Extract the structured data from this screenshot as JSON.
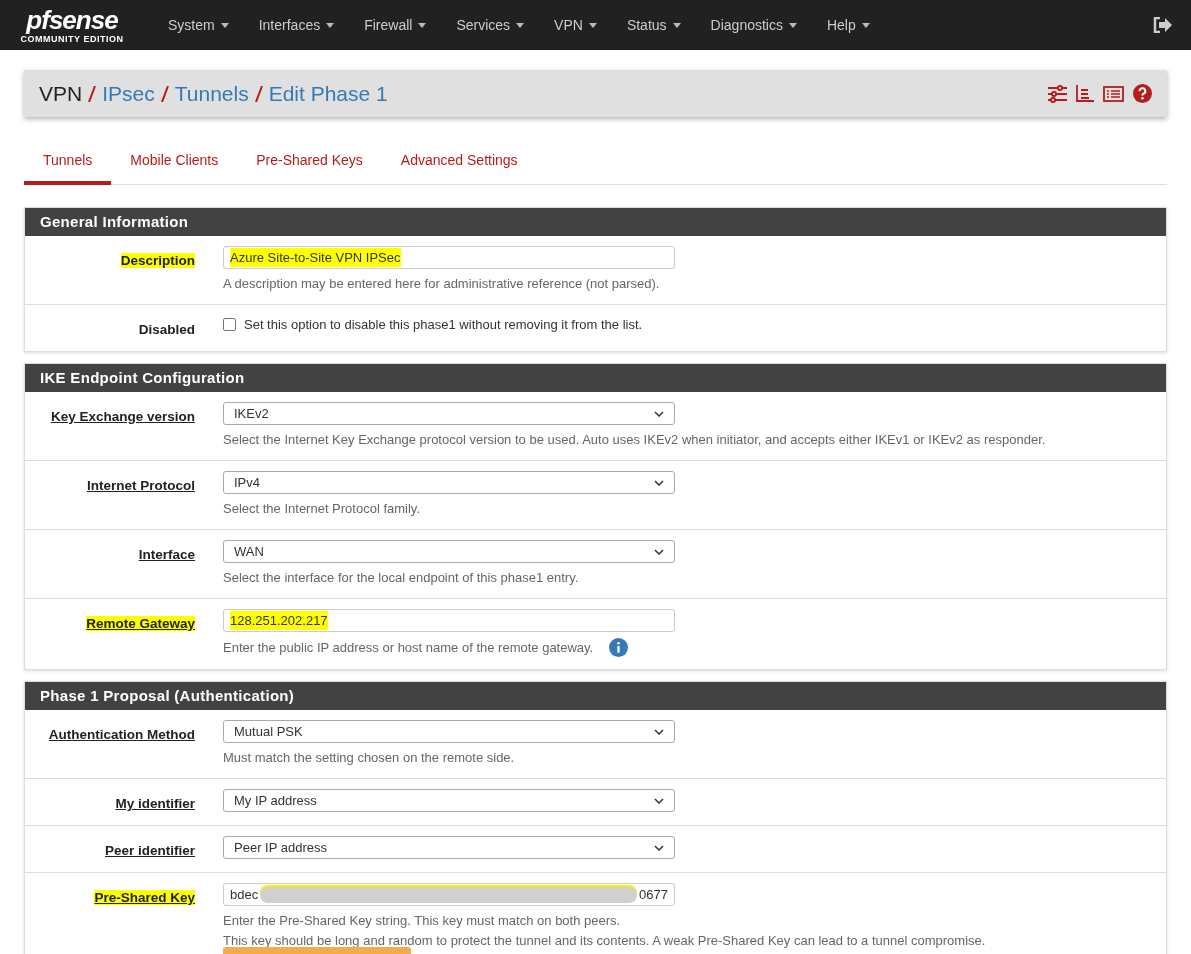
{
  "brand": {
    "logo": "pfsense",
    "edition": "COMMUNITY EDITION"
  },
  "nav": [
    "System",
    "Interfaces",
    "Firewall",
    "Services",
    "VPN",
    "Status",
    "Diagnostics",
    "Help"
  ],
  "breadcrumb": [
    {
      "label": "VPN",
      "link": false
    },
    {
      "label": "IPsec",
      "link": true
    },
    {
      "label": "Tunnels",
      "link": true
    },
    {
      "label": "Edit Phase 1",
      "link": true
    }
  ],
  "tabs": [
    {
      "label": "Tunnels",
      "selected": true
    },
    {
      "label": "Mobile Clients",
      "selected": false
    },
    {
      "label": "Pre-Shared Keys",
      "selected": false
    },
    {
      "label": "Advanced Settings",
      "selected": false
    }
  ],
  "sections": [
    {
      "title": "General Information",
      "rows": [
        {
          "kind": "text",
          "label": "Description",
          "underlined": false,
          "highlighted": true,
          "value": "Azure Site-to-Site VPN IPSec",
          "help": [
            "A description may be entered here for administrative reference (not parsed)."
          ]
        },
        {
          "kind": "checkbox",
          "label": "Disabled",
          "underlined": false,
          "highlighted": false,
          "checked": false,
          "value": "Set this option to disable this phase1 without removing it from the list."
        }
      ]
    },
    {
      "title": "IKE Endpoint Configuration",
      "rows": [
        {
          "kind": "select",
          "label": "Key Exchange version",
          "underlined": true,
          "highlighted": false,
          "value": "IKEv2",
          "help": [
            "Select the Internet Key Exchange protocol version to be used. Auto uses IKEv2 when initiator, and accepts either IKEv1 or IKEv2 as responder."
          ]
        },
        {
          "kind": "select",
          "label": "Internet Protocol",
          "underlined": true,
          "highlighted": false,
          "value": "IPv4",
          "help": [
            "Select the Internet Protocol family."
          ]
        },
        {
          "kind": "select",
          "label": "Interface",
          "underlined": true,
          "highlighted": false,
          "value": "WAN",
          "help": [
            "Select the interface for the local endpoint of this phase1 entry."
          ]
        },
        {
          "kind": "text",
          "label": "Remote Gateway",
          "underlined": true,
          "highlighted": true,
          "info": true,
          "value": "128.251.202.217",
          "help": [
            "Enter the public IP address or host name of the remote gateway."
          ]
        }
      ]
    },
    {
      "title": "Phase 1 Proposal (Authentication)",
      "rows": [
        {
          "kind": "select",
          "label": "Authentication Method",
          "underlined": true,
          "highlighted": false,
          "value": "Mutual PSK",
          "help": [
            "Must match the setting chosen on the remote side."
          ]
        },
        {
          "kind": "select",
          "label": "My identifier",
          "underlined": true,
          "highlighted": false,
          "value": "My IP address"
        },
        {
          "kind": "select",
          "label": "Peer identifier",
          "underlined": true,
          "highlighted": false,
          "value": "Peer IP address"
        },
        {
          "kind": "secret",
          "label": "Pre-Shared Key",
          "underlined": true,
          "highlighted": true,
          "value_start": "bdec",
          "value_end": "0677",
          "help": [
            "Enter the Pre-Shared Key string. This key must match on both peers.",
            "This key should be long and random to protect the tunnel and its contents. A weak Pre-Shared Key can lead to a tunnel compromise."
          ]
        }
      ]
    }
  ]
}
